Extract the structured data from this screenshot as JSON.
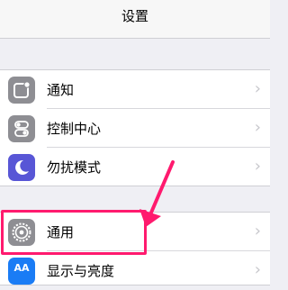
{
  "navbar": {
    "title": "设置"
  },
  "colors": {
    "background": "#efeff4",
    "annotation": "#ff1a6e",
    "notification_icon": "#8e8e93",
    "control_center_icon": "#8e8e93",
    "dnd_icon": "#5856d6",
    "general_icon": "#8e8e93",
    "display_icon": "#1a7cf5"
  },
  "settings": {
    "group1": [
      {
        "label": "通知",
        "icon": "notification-icon"
      },
      {
        "label": "控制中心",
        "icon": "control-center-icon"
      },
      {
        "label": "勿扰模式",
        "icon": "moon-icon"
      }
    ],
    "group2": [
      {
        "label": "通用",
        "icon": "gear-icon"
      },
      {
        "label": "显示与亮度",
        "icon": "display-icon",
        "icon_text": "AA"
      }
    ],
    "chevron": "›"
  }
}
